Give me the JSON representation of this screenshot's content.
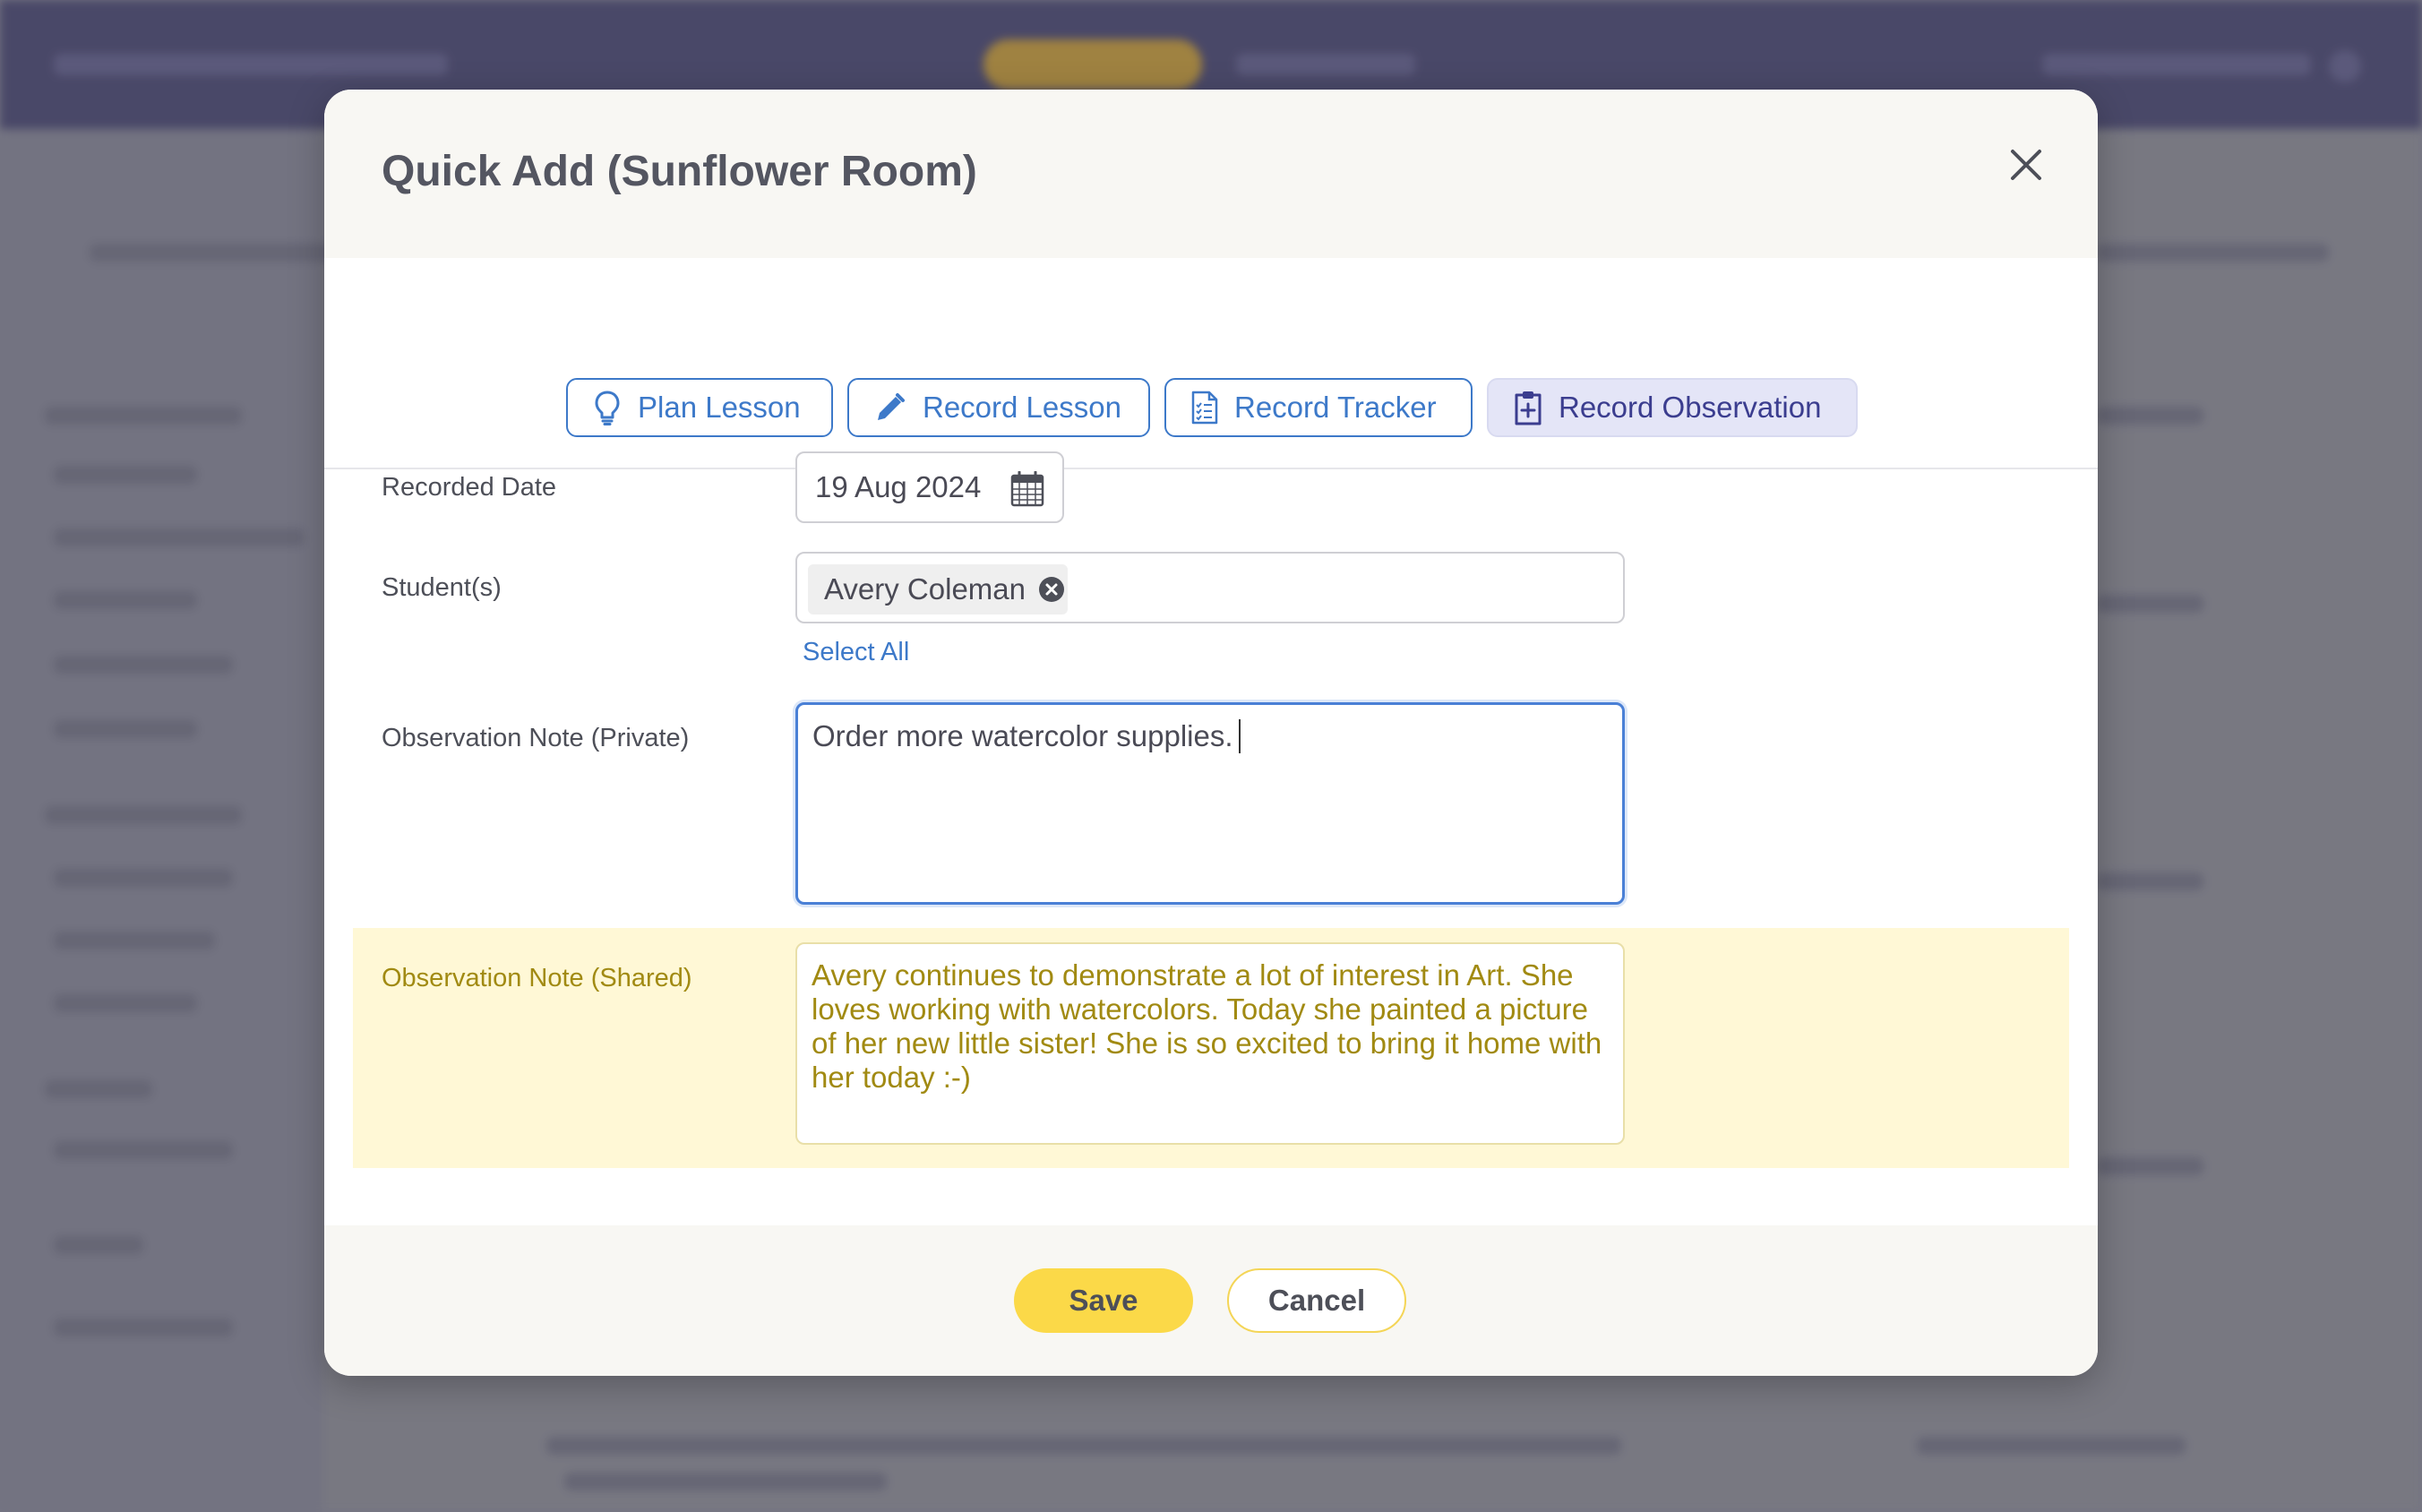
{
  "modal": {
    "title": "Quick Add (Sunflower Room)",
    "close_icon": "close-icon"
  },
  "tabs": [
    {
      "label": "Plan Lesson",
      "icon": "lightbulb-icon",
      "active": false
    },
    {
      "label": "Record Lesson",
      "icon": "pencil-icon",
      "active": false
    },
    {
      "label": "Record Tracker",
      "icon": "checklist-document-icon",
      "active": false
    },
    {
      "label": "Record Observation",
      "icon": "clipboard-plus-icon",
      "active": true
    }
  ],
  "form": {
    "recorded_date_label": "Recorded Date",
    "recorded_date_value": "19 Aug 2024",
    "students_label": "Student(s)",
    "students": [
      {
        "name": "Avery Coleman"
      }
    ],
    "select_all_label": "Select All",
    "private_note_label": "Observation Note (Private)",
    "private_note_value": "Order more watercolor supplies.",
    "shared_note_label": "Observation Note (Shared)",
    "shared_note_value": "Avery continues to demonstrate a lot of interest in Art. She loves working with watercolors. Today she painted a picture of her new little sister! She is so excited to bring it home with her today :-)"
  },
  "footer": {
    "save_label": "Save",
    "cancel_label": "Cancel"
  },
  "colors": {
    "accent_blue": "#3d79c9",
    "save_yellow": "#fbd948",
    "shared_band": "#fff8d6",
    "shared_text": "#a18a12",
    "active_tab_bg": "#e4e5f7"
  }
}
